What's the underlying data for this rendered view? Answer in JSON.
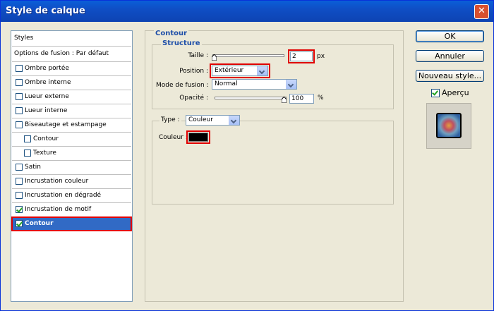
{
  "window": {
    "title": "Style de calque",
    "close_glyph": "✕"
  },
  "styles_list": {
    "header": "Styles",
    "blending": "Options de fusion : Par défaut",
    "items": [
      {
        "label": "Ombre portée",
        "checked": false,
        "indent": false
      },
      {
        "label": "Ombre interne",
        "checked": false,
        "indent": false
      },
      {
        "label": "Lueur externe",
        "checked": false,
        "indent": false
      },
      {
        "label": "Lueur interne",
        "checked": false,
        "indent": false
      },
      {
        "label": "Biseautage et estampage",
        "checked": false,
        "indent": false
      },
      {
        "label": "Contour",
        "checked": false,
        "indent": true
      },
      {
        "label": "Texture",
        "checked": false,
        "indent": true
      },
      {
        "label": "Satin",
        "checked": false,
        "indent": false
      },
      {
        "label": "Incrustation couleur",
        "checked": false,
        "indent": false
      },
      {
        "label": "Incrustation en dégradé",
        "checked": false,
        "indent": false
      },
      {
        "label": "Incrustation de motif",
        "checked": true,
        "indent": false
      },
      {
        "label": "Contour",
        "checked": true,
        "indent": false,
        "selected": true
      }
    ]
  },
  "contour": {
    "title": "Contour",
    "structure": {
      "title": "Structure",
      "size_label": "Taille :",
      "size_value": "2",
      "size_unit": "px",
      "position_label": "Position :",
      "position_value": "Extérieur",
      "blend_label": "Mode de fusion :",
      "blend_value": "Normal",
      "opacity_label": "Opacité :",
      "opacity_value": "100",
      "opacity_unit": "%"
    },
    "fill": {
      "type_label": "Type :",
      "type_value": "Couleur",
      "color_label": "Couleur :",
      "color_hex": "#000000"
    }
  },
  "buttons": {
    "ok": "OK",
    "cancel": "Annuler",
    "new_style": "Nouveau style...",
    "preview": "Aperçu",
    "preview_checked": true
  },
  "colors": {
    "titlebar": "#0d43b3",
    "selection": "#316ac5",
    "highlight": "#e00000",
    "legend": "#1e4ea8"
  }
}
